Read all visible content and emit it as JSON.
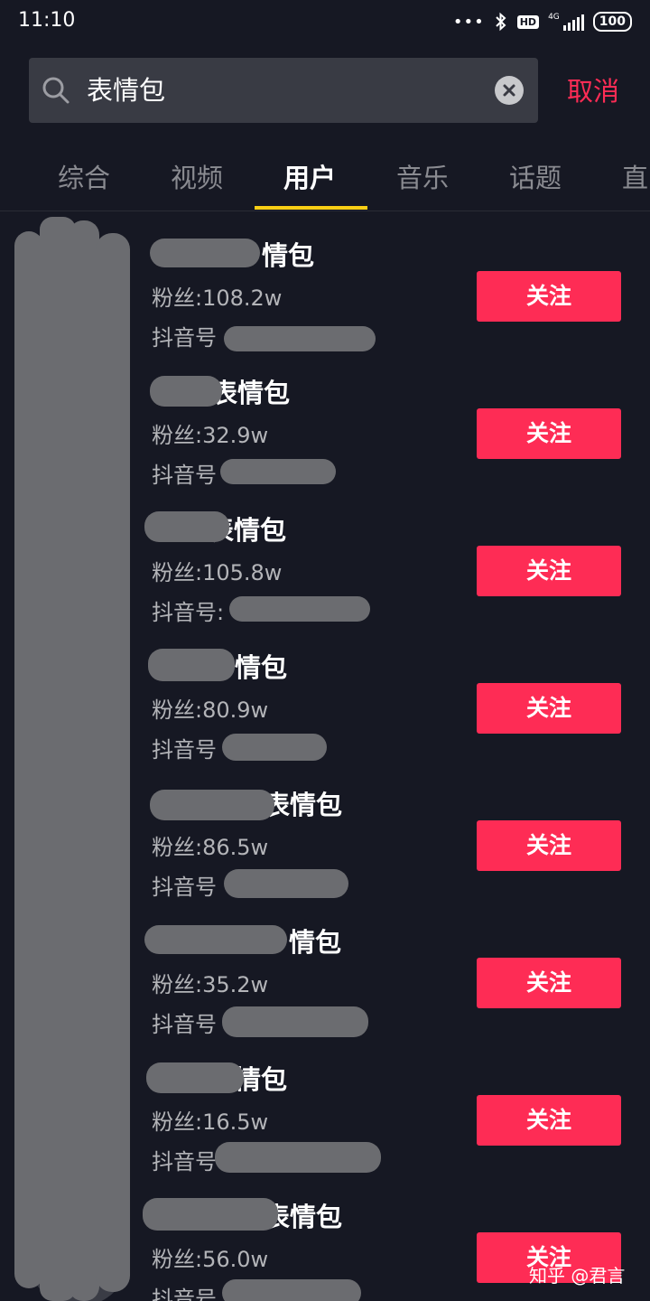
{
  "status_bar": {
    "time": "11:10",
    "network": "4G",
    "hd": "HD",
    "battery": "100"
  },
  "search": {
    "query": "表情包",
    "cancel_label": "取消"
  },
  "tabs": [
    {
      "label": "综合"
    },
    {
      "label": "视频"
    },
    {
      "label": "用户",
      "active": true
    },
    {
      "label": "音乐"
    },
    {
      "label": "话题"
    },
    {
      "label": "直"
    }
  ],
  "results": [
    {
      "name_suffix": "情包",
      "fans": "粉丝:108.2w",
      "id_label": "抖音号",
      "follow_label": "关注"
    },
    {
      "name_suffix": "表情包",
      "fans": "粉丝:32.9w",
      "id_label": "抖音号",
      "follow_label": "关注"
    },
    {
      "name_suffix": "表情包",
      "fans": "粉丝:105.8w",
      "id_label": "抖音号:",
      "follow_label": "关注"
    },
    {
      "name_suffix": "情包",
      "fans": "粉丝:80.9w",
      "id_label": "抖音号",
      "follow_label": "关注"
    },
    {
      "name_suffix": "表情包",
      "fans": "粉丝:86.5w",
      "id_label": "抖音号",
      "follow_label": "关注"
    },
    {
      "name_suffix": "情包",
      "fans": "粉丝:35.2w",
      "id_label": "抖音号",
      "follow_label": "关注"
    },
    {
      "name_suffix": "情包",
      "fans": "粉丝:16.5w",
      "id_label": "抖音号",
      "follow_label": "关注"
    },
    {
      "name_suffix": "表情包",
      "fans": "粉丝:56.0w",
      "id_label": "抖音号",
      "follow_label": "关注"
    }
  ],
  "watermark": "知乎 @君言",
  "colors": {
    "background": "#161823",
    "accent": "#fe2c55",
    "tab_indicator": "#face15",
    "redaction": "#6b6c70"
  }
}
